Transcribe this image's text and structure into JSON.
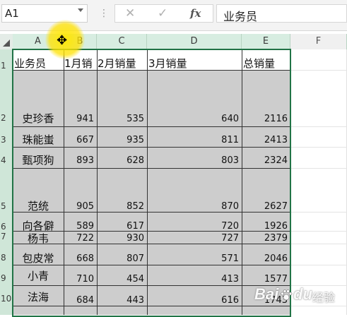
{
  "name_box": "A1",
  "formula_bar": {
    "cancel_glyph": "✕",
    "enter_glyph": "✓",
    "fx_label": "fx",
    "content": "业务员"
  },
  "columns": [
    "A",
    "B",
    "C",
    "D",
    "E",
    "F"
  ],
  "rows": [
    "1",
    "2",
    "3",
    "4",
    "5",
    "6",
    "7",
    "8",
    "9",
    "10"
  ],
  "headers": {
    "a": "业务员",
    "b": "1月销",
    "c": "2月销量",
    "d": "3月销量",
    "e": "总销量"
  },
  "table": [
    {
      "name": "史珍香",
      "m1": "941",
      "m2": "535",
      "m3": "640",
      "total": "2116"
    },
    {
      "name": "珠能蚩",
      "m1": "667",
      "m2": "935",
      "m3": "811",
      "total": "2413"
    },
    {
      "name": "甄项狗",
      "m1": "893",
      "m2": "628",
      "m3": "803",
      "total": "2324"
    },
    {
      "name": "范统",
      "m1": "905",
      "m2": "852",
      "m3": "870",
      "total": "2627"
    },
    {
      "name": "向各僻",
      "m1": "589",
      "m2": "617",
      "m3": "720",
      "total": "1926"
    },
    {
      "name": "杨韦",
      "m1": "722",
      "m2": "930",
      "m3": "727",
      "total": "2379"
    },
    {
      "name": "包皮常",
      "m1": "668",
      "m2": "807",
      "m3": "571",
      "total": "2046"
    },
    {
      "name": "小青",
      "m1": "710",
      "m2": "454",
      "m3": "413",
      "total": "1577"
    },
    {
      "name": "法海",
      "m1": "684",
      "m2": "443",
      "m3": "616",
      "total": "1743"
    }
  ],
  "cursor_glyph": "✥",
  "watermark": {
    "brand": "Bai",
    "brand2": "du",
    "suffix": "经验"
  },
  "colors": {
    "selection_border": "#217346",
    "header_selected": "#d7ede1",
    "selection_fill": "#cdcdcd"
  }
}
